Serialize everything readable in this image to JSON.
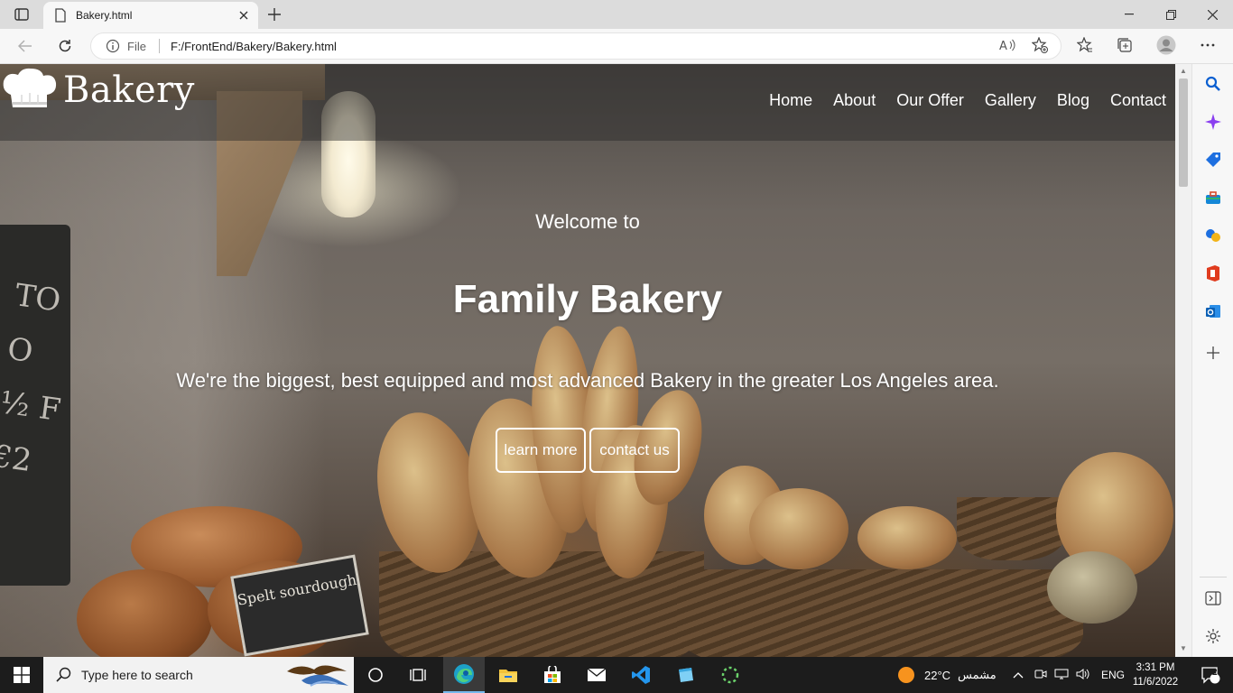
{
  "browser": {
    "tab_title": "Bakery.html",
    "address_prefix": "File",
    "url": "F:/FrontEnd/Bakery/Bakery.html"
  },
  "site": {
    "brand": "Bakery",
    "nav": [
      "Home",
      "About",
      "Our Offer",
      "Gallery",
      "Blog",
      "Contact"
    ],
    "welcome": "Welcome to",
    "headline": "Family Bakery",
    "tagline": "We're the biggest, best equipped and most advanced Bakery in the greater Los Angeles area.",
    "buttons": {
      "learn_more": "learn more",
      "contact_us": "contact us"
    },
    "image_sign": "Spelt sourdough",
    "chalkboard": "TOO ½ F €2"
  },
  "taskbar": {
    "search_placeholder": "Type here to search",
    "weather_temp": "22°C",
    "weather_label": "مشمس",
    "language": "ENG",
    "time": "3:31 PM",
    "date": "11/6/2022",
    "notification_count": "2"
  },
  "icons": {
    "tab_actions": "tab-actions-icon",
    "back": "back-arrow-icon",
    "refresh": "refresh-icon",
    "info": "info-icon",
    "read_aloud": "read-aloud-icon",
    "add_favorite": "add-favorite-icon",
    "favorites": "favorites-icon",
    "collections": "collections-icon",
    "profile": "profile-icon",
    "more": "more-icon"
  },
  "colors": {
    "accent_edge": "#0078d4",
    "taskbar": "#1c1c1c",
    "header_overlay": "rgba(40,40,40,0.45)"
  }
}
